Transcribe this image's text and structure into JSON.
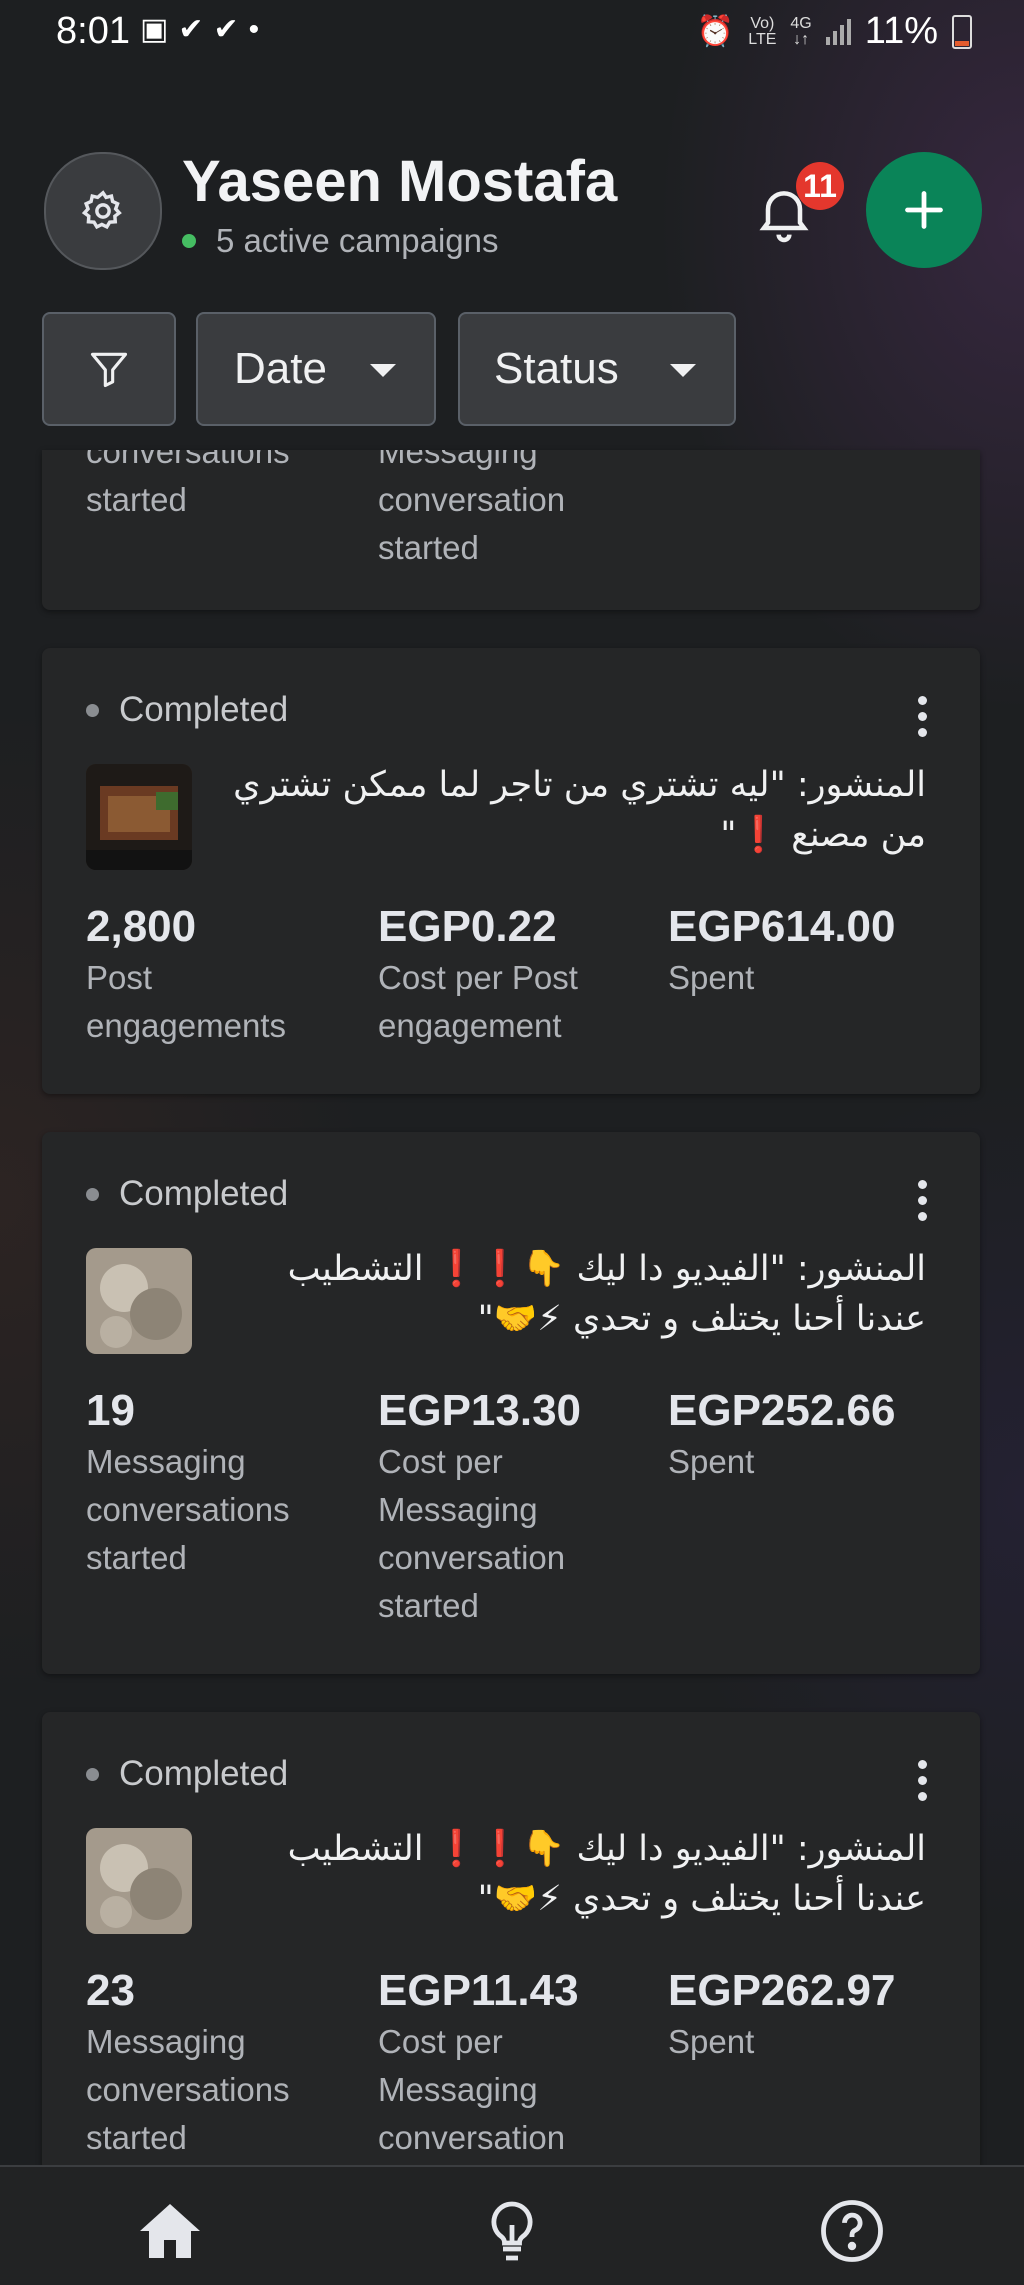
{
  "status_bar": {
    "time": "8:01",
    "left_icons": [
      "image-icon",
      "check-icon",
      "check-icon",
      "dot-icon"
    ],
    "network_top": "Vo)",
    "network_bottom": "LTE",
    "gen_top": "4G",
    "battery": "11%"
  },
  "header": {
    "name": "Yaseen Mostafa",
    "subtitle": "5 active campaigns",
    "notification_count": "11",
    "accent_color": "#0a8458"
  },
  "filters": {
    "date_label": "Date",
    "status_label": "Status"
  },
  "card0": {
    "metric1_label": "conversations\nstarted",
    "metric2_label": "Messaging\nconversation\nstarted"
  },
  "cards": [
    {
      "status": "Completed",
      "post": "المنشور: \"ليه تشتري من تاجر لما ممكن تشتري من مصنع ❗\"",
      "m1_value": "2,800",
      "m1_label": "Post\nengagements",
      "m2_value": "EGP0.22",
      "m2_label": "Cost per Post\nengagement",
      "m3_value": "EGP614.00",
      "m3_label": "Spent"
    },
    {
      "status": "Completed",
      "post": "المنشور: \"الفيديو دا ليك 👇❗❗ التشطيب عندنا أحنا يختلف و تحدي ⚡🤝\"",
      "m1_value": "19",
      "m1_label": "Messaging\nconversations\nstarted",
      "m2_value": "EGP13.30",
      "m2_label": "Cost per\nMessaging\nconversation\nstarted",
      "m3_value": "EGP252.66",
      "m3_label": "Spent"
    },
    {
      "status": "Completed",
      "post": "المنشور: \"الفيديو دا ليك 👇❗❗ التشطيب عندنا أحنا يختلف و تحدي ⚡🤝\"",
      "m1_value": "23",
      "m1_label": "Messaging\nconversations\nstarted",
      "m2_value": "EGP11.43",
      "m2_label": "Cost per\nMessaging\nconversation",
      "m3_value": "EGP262.97",
      "m3_label": "Spent"
    }
  ],
  "bottom_nav": [
    "home-icon",
    "lightbulb-icon",
    "help-icon"
  ]
}
